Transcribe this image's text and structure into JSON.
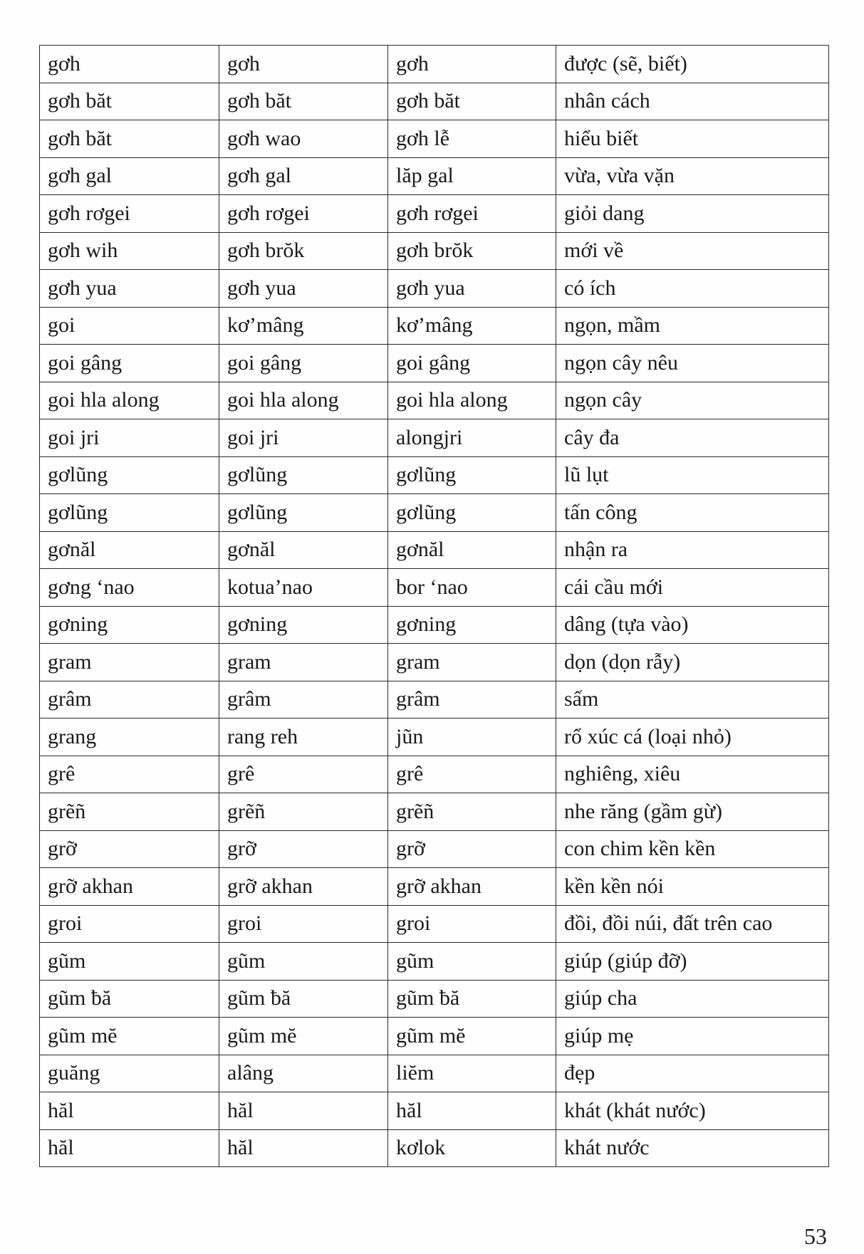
{
  "rows": [
    [
      "gơh",
      "gơh",
      "gơh",
      "được (sẽ, biết)"
    ],
    [
      "gơh băt",
      "gơh băt",
      "gơh băt",
      "nhân cách"
    ],
    [
      "gơh băt",
      "gơh wao",
      "gơh lễ",
      "hiểu biết"
    ],
    [
      "gơh gal",
      "gơh gal",
      "lăp gal",
      "vừa, vừa vặn"
    ],
    [
      "gơh rơgei",
      "gơh rơgei",
      "gơh rơgei",
      "giỏi dang"
    ],
    [
      "gơh wih",
      "gơh brŏk",
      "gơh brŏk",
      "mới về"
    ],
    [
      "gơh yua",
      "gơh yua",
      "gơh yua",
      "có ích"
    ],
    [
      "goi",
      "kơ’mâng",
      "kơ’mâng",
      "ngọn, mầm"
    ],
    [
      "goi gâng",
      "goi gâng",
      "goi gâng",
      "ngọn cây nêu"
    ],
    [
      "goi hla along",
      "goi hla along",
      "goi hla along",
      "ngọn cây"
    ],
    [
      "goi jri",
      "goi jri",
      "alongjri",
      "cây đa"
    ],
    [
      "gơlũng",
      "gơlũng",
      "gơlũng",
      "lũ lụt"
    ],
    [
      "gơlũng",
      "gơlũng",
      "gơlũng",
      "tấn công"
    ],
    [
      "gơnăl",
      "gơnăl",
      "gơnăl",
      "nhận ra"
    ],
    [
      "gơng ‘nao",
      "kotua’nao",
      "bor ‘nao",
      "cái cầu mới"
    ],
    [
      "gơning",
      "gơning",
      "gơning",
      "dâng (tựa vào)"
    ],
    [
      "gram",
      "gram",
      "gram",
      "dọn (dọn rẫy)"
    ],
    [
      "grâm",
      "grâm",
      "grâm",
      "sấm"
    ],
    [
      "grang",
      "rang reh",
      "jũn",
      "rổ xúc cá (loại nhỏ)"
    ],
    [
      "grê",
      "grê",
      "grê",
      "nghiêng, xiêu"
    ],
    [
      "grẽñ",
      "grẽñ",
      "grẽñ",
      "nhe răng (gầm gừ)"
    ],
    [
      "grỡ",
      "grỡ",
      "grỡ",
      "con chim kền kền"
    ],
    [
      "grỡ akhan",
      "grỡ akhan",
      "grỡ akhan",
      "kền kền nói"
    ],
    [
      "groi",
      "groi",
      "groi",
      "đồi, đồi núi, đất trên cao"
    ],
    [
      "gũm",
      "gũm",
      "gũm",
      "giúp (giúp đỡ)"
    ],
    [
      "gũm ƀă",
      "gũm ƀă",
      "gũm ƀă",
      "giúp cha"
    ],
    [
      "gũm mĕ",
      "gũm mĕ",
      "gũm mĕ",
      "giúp mẹ"
    ],
    [
      "guăng",
      "alâng",
      "liĕm",
      "đẹp"
    ],
    [
      "hăl",
      "hăl",
      "hăl",
      "khát (khát nước)"
    ],
    [
      "hăl",
      "hăl",
      "kơlok",
      "khát nước"
    ]
  ],
  "page_number": "53"
}
